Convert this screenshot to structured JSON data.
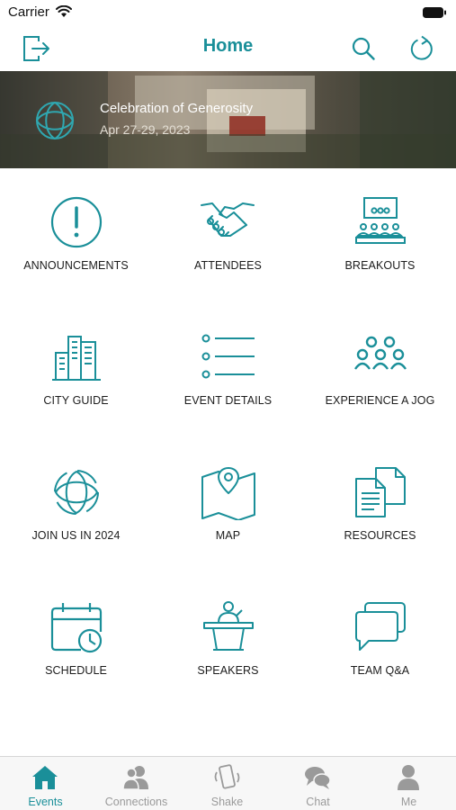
{
  "status_bar": {
    "carrier": "Carrier"
  },
  "navbar": {
    "title": "Home"
  },
  "banner": {
    "title": "Celebration of Generosity",
    "date": "Apr 27-29, 2023"
  },
  "tiles": [
    {
      "label": "ANNOUNCEMENTS",
      "icon": "announcement-icon"
    },
    {
      "label": "ATTENDEES",
      "icon": "handshake-icon"
    },
    {
      "label": "BREAKOUTS",
      "icon": "presentation-icon"
    },
    {
      "label": "CITY GUIDE",
      "icon": "city-icon"
    },
    {
      "label": "EVENT DETAILS",
      "icon": "list-icon"
    },
    {
      "label": "EXPERIENCE A JOG",
      "icon": "group-icon"
    },
    {
      "label": "JOIN US IN 2024",
      "icon": "logo-icon"
    },
    {
      "label": "MAP",
      "icon": "map-icon"
    },
    {
      "label": "RESOURCES",
      "icon": "documents-icon"
    },
    {
      "label": "SCHEDULE",
      "icon": "calendar-clock-icon"
    },
    {
      "label": "SPEAKERS",
      "icon": "podium-icon"
    },
    {
      "label": "TEAM Q&A",
      "icon": "chat-bubbles-icon"
    }
  ],
  "tabbar": {
    "items": [
      {
        "label": "Events",
        "icon": "home-icon",
        "active": true
      },
      {
        "label": "Connections",
        "icon": "people-icon",
        "active": false
      },
      {
        "label": "Shake",
        "icon": "phone-shake-icon",
        "active": false
      },
      {
        "label": "Chat",
        "icon": "chat-icon",
        "active": false
      },
      {
        "label": "Me",
        "icon": "person-icon",
        "active": false
      }
    ]
  },
  "colors": {
    "accent": "#1a8f99",
    "inactive": "#9a9a9a"
  }
}
